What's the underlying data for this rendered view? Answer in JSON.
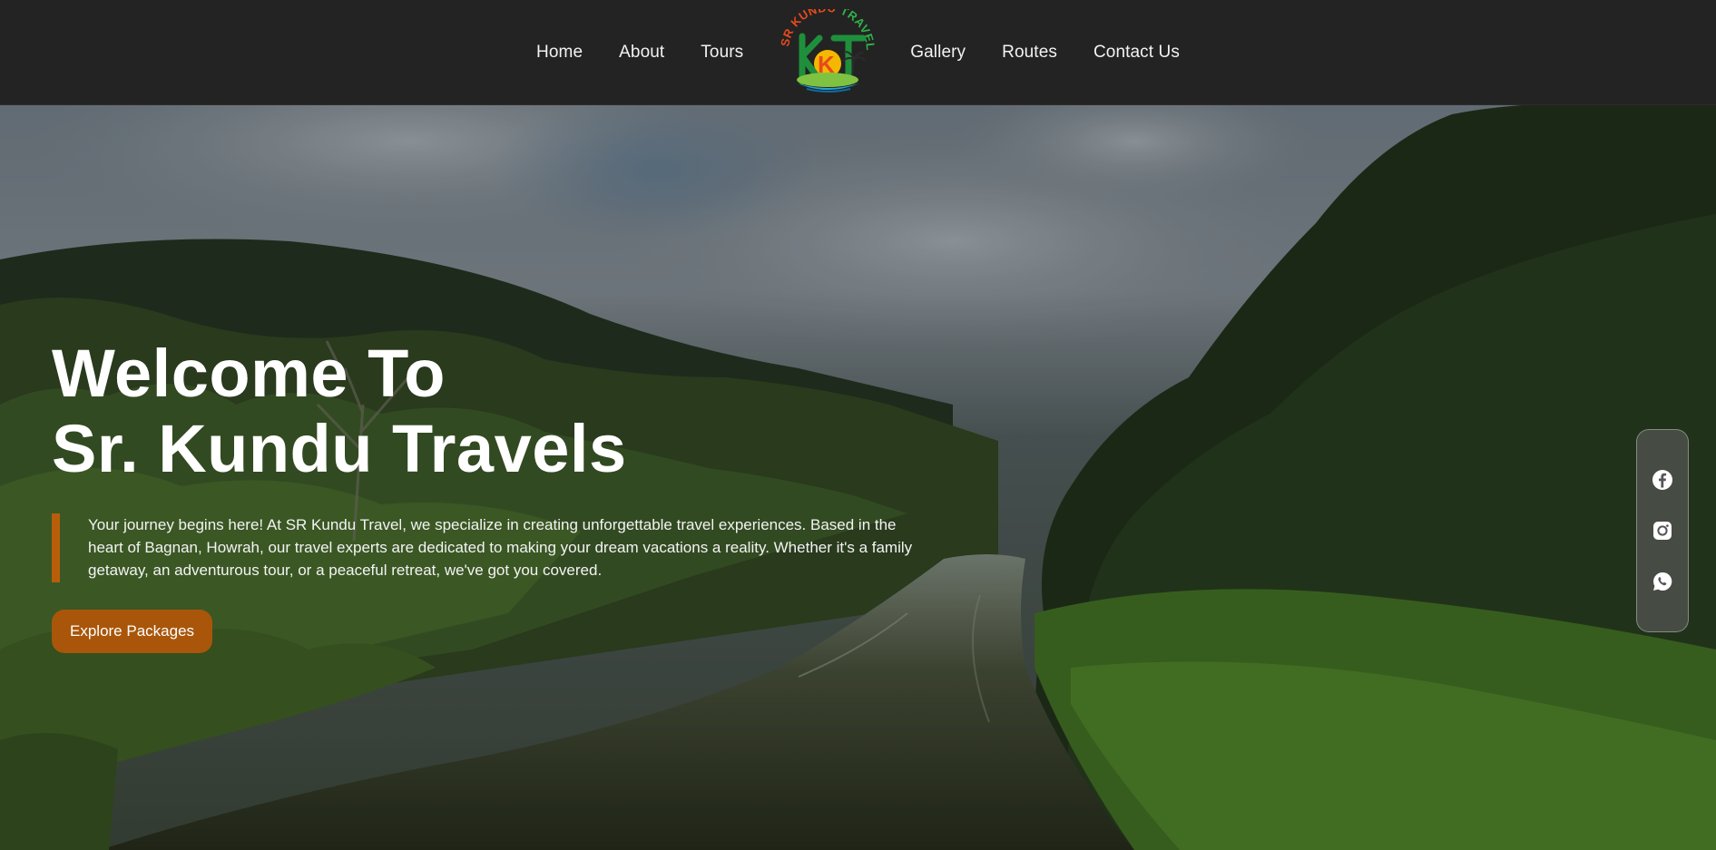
{
  "nav": {
    "left": [
      "Home",
      "About",
      "Tours"
    ],
    "right": [
      "Gallery",
      "Routes",
      "Contact Us"
    ],
    "logo_text": "SR KUNDU TRAVEL",
    "logo_letters": "KT"
  },
  "hero": {
    "title_line1": "Welcome To",
    "title_line2": "Sr. Kundu Travels",
    "description": "Your journey begins here! At SR Kundu Travel, we specialize in creating unforgettable travel experiences. Based in the heart of Bagnan, Howrah, our travel experts are dedicated to making your dream vacations a reality. Whether it's a family getaway, an adventurous tour, or a peaceful retreat, we've got you covered.",
    "cta_label": "Explore Packages"
  },
  "social": {
    "icons": [
      "facebook-icon",
      "instagram-icon",
      "whatsapp-icon"
    ]
  },
  "colors": {
    "accent": "#b85e0a",
    "navbar_bg": "#232323",
    "logo_red": "#e8491d",
    "logo_green": "#2fb34a"
  }
}
